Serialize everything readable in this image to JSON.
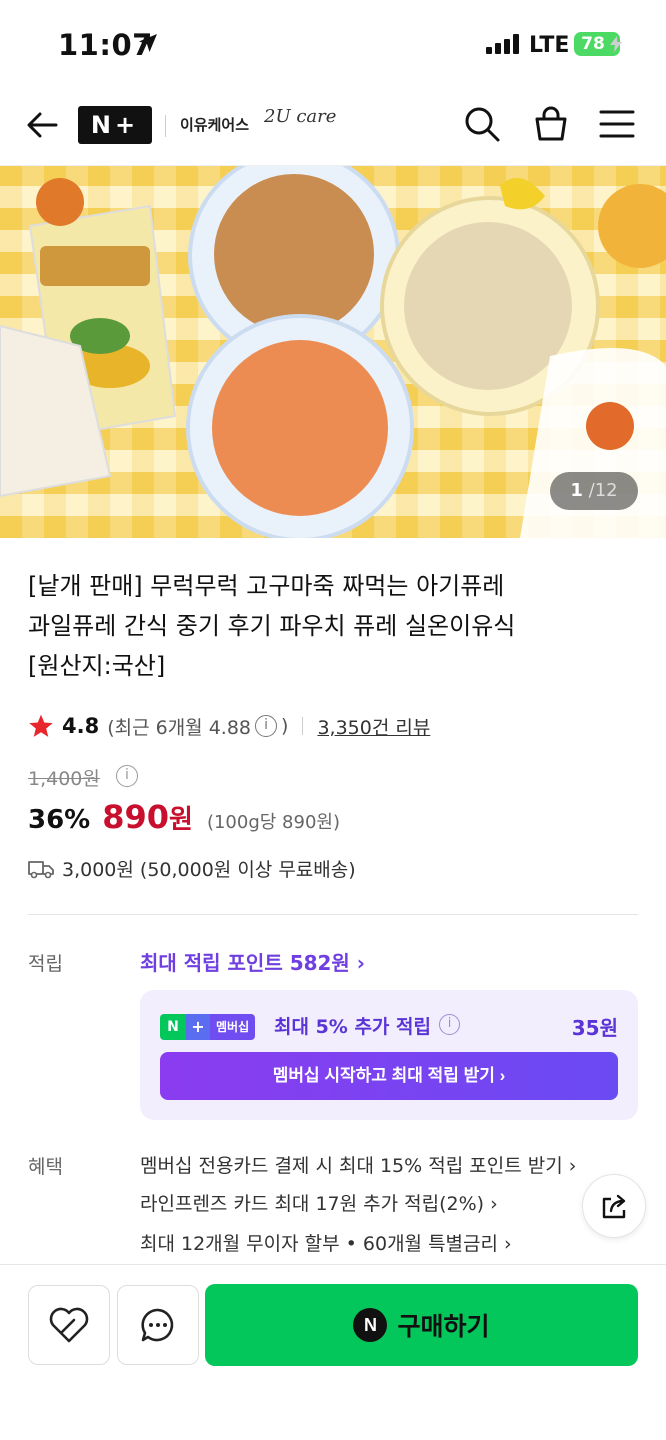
{
  "status": {
    "time": "11:07",
    "network": "LTE",
    "battery": "78"
  },
  "header": {
    "brand_logo": "N+",
    "store_name": "이유케어스",
    "store_logo": "2U care"
  },
  "hero": {
    "current": "1",
    "total": "/12"
  },
  "product": {
    "title_line1": "[낱개 판매] 무럭무럭 고구마죽 짜먹는 아기퓨레",
    "title_line2": "과일퓨레 간식 중기 후기 파우치 퓨레 실온이유식",
    "title_line3": "[원산지:국산]",
    "rating": "4.8",
    "recent_rating": "(최근 6개월 4.88",
    "recent_close": ")",
    "reviews": "3,350건 리뷰",
    "original_price": "1,400원",
    "discount": "36%",
    "price": "890",
    "currency": "원",
    "unit_price": "(100g당 890원)",
    "shipping": "3,000원 (50,000원 이상 무료배송)"
  },
  "points": {
    "label": "적립",
    "max_points": "최대 적립 포인트 582원 ›",
    "membership_badge": "멤버십",
    "membership_text": "최대 5% 추가 적립",
    "membership_amount": "35원",
    "membership_button": "멤버십 시작하고 최대 적립 받기 ›"
  },
  "benefits": {
    "label": "혜택",
    "items": [
      "멤버십 전용카드 결제 시 최대 15% 적립 포인트 받기 ›",
      "라인프렌즈 카드 최대 17원 추가 적립(2%) ›",
      "최대 12개월 무이자 할부 • 60개월 특별금리 ›"
    ]
  },
  "bottom": {
    "buy_label": "구매하기",
    "buy_icon": "N"
  },
  "colors": {
    "accent_purple": "#6f3fe0",
    "price_red": "#c8102e",
    "buy_green": "#03c75a"
  }
}
